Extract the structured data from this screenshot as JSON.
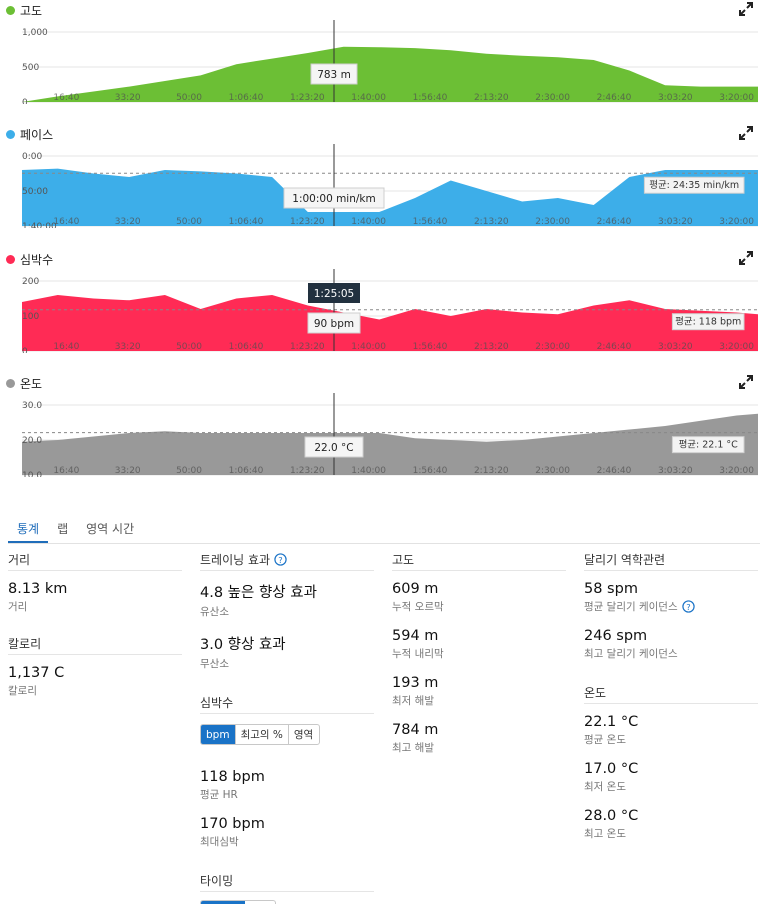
{
  "colors": {
    "altitude": "#6cbf35",
    "pace": "#3daee9",
    "heart": "#ff2b55",
    "temp": "#999999",
    "accent": "#1a73c7"
  },
  "x_ticks": [
    "16:40",
    "33:20",
    "50:00",
    "1:06:40",
    "1:23:20",
    "1:40:00",
    "1:56:40",
    "2:13:20",
    "2:30:00",
    "2:46:40",
    "3:03:20",
    "3:20:00"
  ],
  "charts": {
    "altitude": {
      "title": "고도",
      "y_ticks": [
        "1,000",
        "500",
        "0"
      ],
      "tooltip": "783 m",
      "avg": ""
    },
    "pace": {
      "title": "페이스",
      "y_ticks": [
        "0:00",
        "50:00",
        "1:40:00"
      ],
      "tooltip": "1:00:00 min/km",
      "avg": "평균: 24:35 min/km"
    },
    "heart": {
      "title": "심박수",
      "y_ticks": [
        "200",
        "100",
        "0"
      ],
      "tooltip": "90 bpm",
      "cursor_time": "1:25:05",
      "avg": "평균: 118 bpm"
    },
    "temp": {
      "title": "온도",
      "y_ticks": [
        "30.0",
        "20.0",
        "10.0"
      ],
      "tooltip": "22.0 °C",
      "avg": "평균: 22.1 °C"
    }
  },
  "chart_data": [
    {
      "type": "area",
      "title": "고도",
      "ylim": [
        0,
        1000
      ],
      "x": [
        0,
        10,
        20,
        30,
        40,
        50,
        60,
        70,
        80,
        90,
        100,
        110,
        120,
        130,
        140,
        150,
        160,
        170,
        180,
        190,
        200,
        206
      ],
      "values": [
        0,
        80,
        150,
        220,
        300,
        380,
        540,
        620,
        700,
        790,
        783,
        770,
        740,
        690,
        660,
        640,
        600,
        450,
        240,
        220,
        220,
        220
      ]
    },
    {
      "type": "area",
      "title": "페이스",
      "ylim": [
        0,
        100
      ],
      "inverted": true,
      "avg": 24.6,
      "x": [
        0,
        10,
        20,
        30,
        40,
        50,
        60,
        70,
        80,
        90,
        100,
        110,
        120,
        130,
        140,
        150,
        160,
        170,
        180,
        190,
        200,
        206
      ],
      "values": [
        20,
        18,
        25,
        30,
        20,
        22,
        25,
        30,
        80,
        80,
        80,
        60,
        35,
        50,
        65,
        60,
        70,
        30,
        20,
        20,
        20,
        20
      ]
    },
    {
      "type": "area",
      "title": "심박수",
      "ylim": [
        0,
        200
      ],
      "avg": 118,
      "x": [
        0,
        10,
        20,
        30,
        40,
        50,
        60,
        70,
        80,
        90,
        100,
        110,
        120,
        130,
        140,
        150,
        160,
        170,
        180,
        190,
        200,
        206
      ],
      "values": [
        140,
        160,
        150,
        145,
        160,
        120,
        150,
        160,
        130,
        110,
        90,
        120,
        100,
        120,
        110,
        105,
        130,
        145,
        120,
        115,
        110,
        105
      ]
    },
    {
      "type": "area",
      "title": "온도",
      "ylim": [
        10,
        30
      ],
      "avg": 22.1,
      "x": [
        0,
        10,
        20,
        30,
        40,
        50,
        60,
        70,
        80,
        90,
        100,
        110,
        120,
        130,
        140,
        150,
        160,
        170,
        180,
        190,
        200,
        206
      ],
      "values": [
        19.5,
        20,
        21,
        22,
        22.5,
        22,
        22,
        22,
        22,
        22,
        22,
        20.5,
        20,
        19.5,
        20,
        21,
        22,
        23,
        24,
        25.5,
        27,
        27.5
      ]
    }
  ],
  "tabs": [
    "통계",
    "랩",
    "영역 시간"
  ],
  "stats": {
    "distance": {
      "header": "거리",
      "value": "8.13 km",
      "label": "거리"
    },
    "calories": {
      "header": "칼로리",
      "value": "1,137 C",
      "label": "칼로리"
    },
    "training": {
      "header": "트레이닝 효과",
      "aero_value": "4.8 높은 향상 효과",
      "aero_label": "유산소",
      "anaero_value": "3.0 향상 효과",
      "anaero_label": "무산소"
    },
    "hr": {
      "header": "심박수",
      "seg": [
        "bpm",
        "최고의 %",
        "영역"
      ],
      "avg_value": "118 bpm",
      "avg_label": "평균 HR",
      "max_value": "170 bpm",
      "max_label": "최대심박"
    },
    "timing": {
      "header": "타이밍"
    },
    "elevation": {
      "header": "고도",
      "gain_value": "609 m",
      "gain_label": "누적 오르막",
      "loss_value": "594 m",
      "loss_label": "누적 내리막",
      "min_value": "193 m",
      "min_label": "최저 해발",
      "max_value": "784 m",
      "max_label": "최고 해발"
    },
    "dynamics": {
      "header": "달리기 역학관련",
      "cad_value": "58 spm",
      "cad_label": "평균 달리기 케이던스",
      "maxcad_value": "246 spm",
      "maxcad_label": "최고 달리기 케이던스"
    },
    "temperature": {
      "header": "온도",
      "avg_value": "22.1 °C",
      "avg_label": "평균 온도",
      "min_value": "17.0 °C",
      "min_label": "최저 온도",
      "max_value": "28.0 °C",
      "max_label": "최고 온도"
    }
  }
}
